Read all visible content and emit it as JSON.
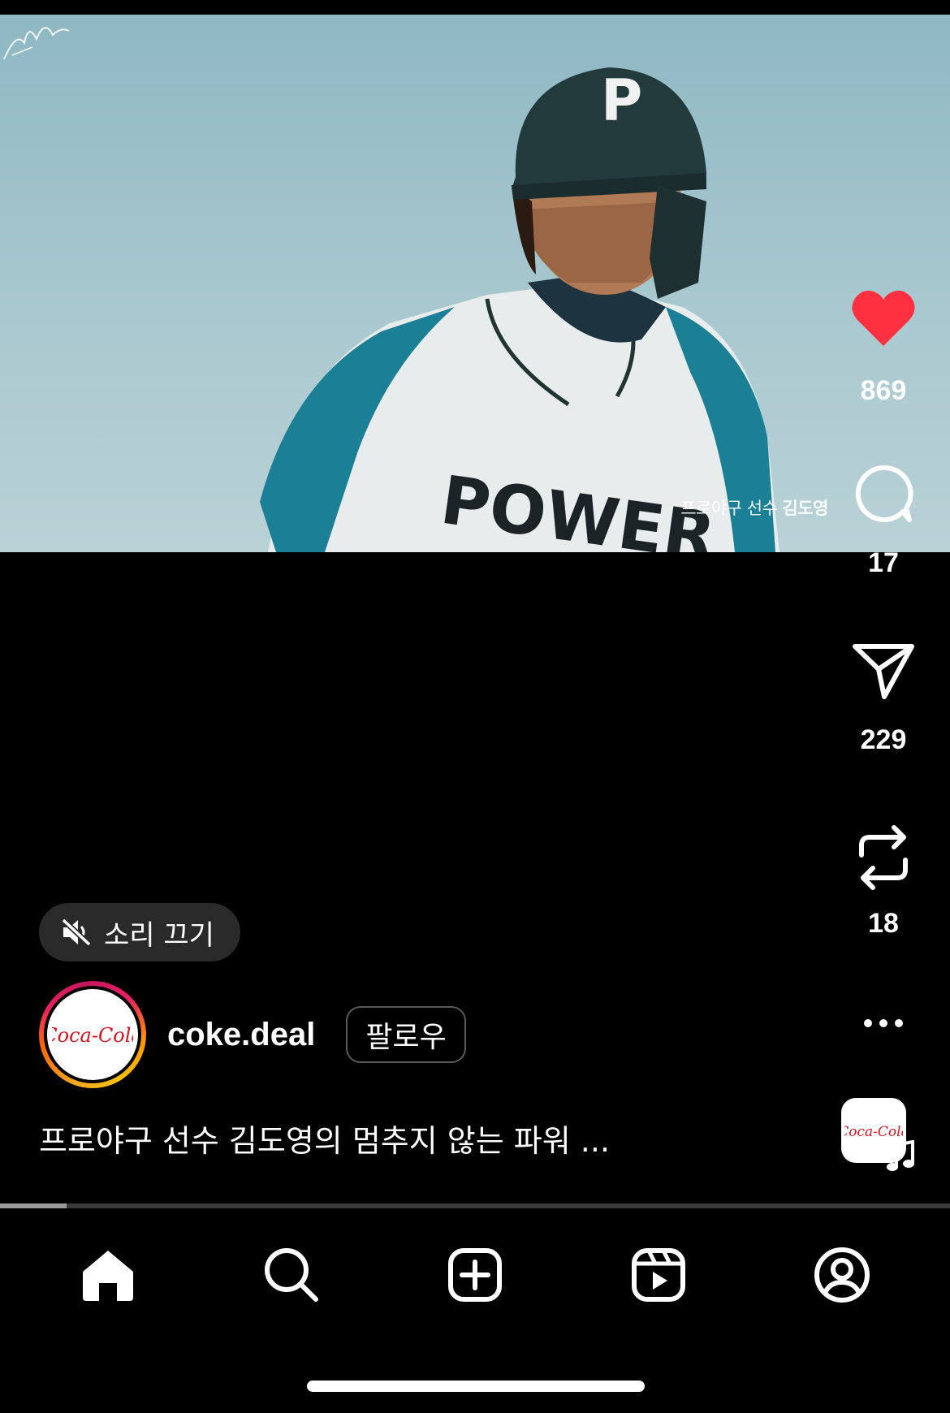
{
  "video": {
    "overlay_caption_prefix": "프로야구 선수",
    "overlay_caption_name": "김도영",
    "jersey_text": "POWER",
    "helmet_letter": "P"
  },
  "actions": {
    "like_count": "869",
    "comment_count": "17",
    "share_count": "229",
    "remix_count": "18",
    "like_color": "#ff3040"
  },
  "mute_button": {
    "label": "소리 끄기"
  },
  "author": {
    "username": "coke.deal",
    "follow_label": "팔로우",
    "avatar_logo_text": "Coca-Cola"
  },
  "post": {
    "caption": "프로야구 선수 김도영의 멈추지 않는 파워 ..."
  },
  "progress": {
    "fraction": 0.07
  },
  "nav": {
    "items": [
      "home-icon",
      "search-icon",
      "create-icon",
      "reels-icon",
      "profile-icon"
    ]
  }
}
